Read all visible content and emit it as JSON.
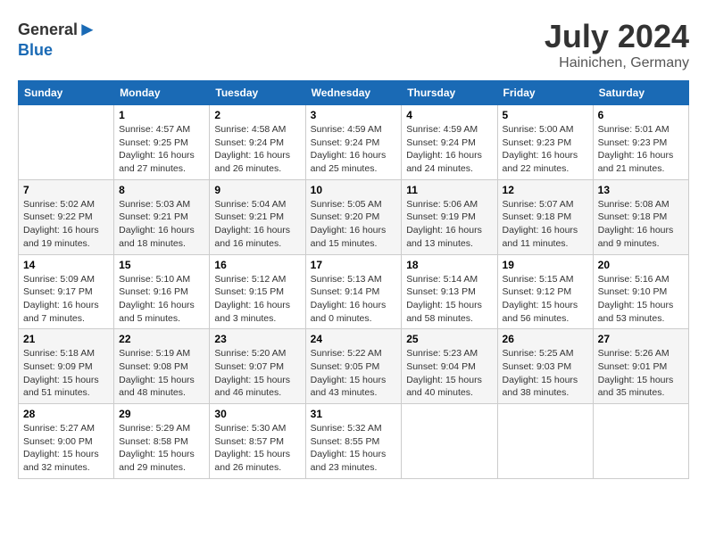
{
  "header": {
    "logo_general": "General",
    "logo_blue": "Blue",
    "month": "July 2024",
    "location": "Hainichen, Germany"
  },
  "weekdays": [
    "Sunday",
    "Monday",
    "Tuesday",
    "Wednesday",
    "Thursday",
    "Friday",
    "Saturday"
  ],
  "weeks": [
    [
      {
        "day": "",
        "info": ""
      },
      {
        "day": "1",
        "info": "Sunrise: 4:57 AM\nSunset: 9:25 PM\nDaylight: 16 hours\nand 27 minutes."
      },
      {
        "day": "2",
        "info": "Sunrise: 4:58 AM\nSunset: 9:24 PM\nDaylight: 16 hours\nand 26 minutes."
      },
      {
        "day": "3",
        "info": "Sunrise: 4:59 AM\nSunset: 9:24 PM\nDaylight: 16 hours\nand 25 minutes."
      },
      {
        "day": "4",
        "info": "Sunrise: 4:59 AM\nSunset: 9:24 PM\nDaylight: 16 hours\nand 24 minutes."
      },
      {
        "day": "5",
        "info": "Sunrise: 5:00 AM\nSunset: 9:23 PM\nDaylight: 16 hours\nand 22 minutes."
      },
      {
        "day": "6",
        "info": "Sunrise: 5:01 AM\nSunset: 9:23 PM\nDaylight: 16 hours\nand 21 minutes."
      }
    ],
    [
      {
        "day": "7",
        "info": "Sunrise: 5:02 AM\nSunset: 9:22 PM\nDaylight: 16 hours\nand 19 minutes."
      },
      {
        "day": "8",
        "info": "Sunrise: 5:03 AM\nSunset: 9:21 PM\nDaylight: 16 hours\nand 18 minutes."
      },
      {
        "day": "9",
        "info": "Sunrise: 5:04 AM\nSunset: 9:21 PM\nDaylight: 16 hours\nand 16 minutes."
      },
      {
        "day": "10",
        "info": "Sunrise: 5:05 AM\nSunset: 9:20 PM\nDaylight: 16 hours\nand 15 minutes."
      },
      {
        "day": "11",
        "info": "Sunrise: 5:06 AM\nSunset: 9:19 PM\nDaylight: 16 hours\nand 13 minutes."
      },
      {
        "day": "12",
        "info": "Sunrise: 5:07 AM\nSunset: 9:18 PM\nDaylight: 16 hours\nand 11 minutes."
      },
      {
        "day": "13",
        "info": "Sunrise: 5:08 AM\nSunset: 9:18 PM\nDaylight: 16 hours\nand 9 minutes."
      }
    ],
    [
      {
        "day": "14",
        "info": "Sunrise: 5:09 AM\nSunset: 9:17 PM\nDaylight: 16 hours\nand 7 minutes."
      },
      {
        "day": "15",
        "info": "Sunrise: 5:10 AM\nSunset: 9:16 PM\nDaylight: 16 hours\nand 5 minutes."
      },
      {
        "day": "16",
        "info": "Sunrise: 5:12 AM\nSunset: 9:15 PM\nDaylight: 16 hours\nand 3 minutes."
      },
      {
        "day": "17",
        "info": "Sunrise: 5:13 AM\nSunset: 9:14 PM\nDaylight: 16 hours\nand 0 minutes."
      },
      {
        "day": "18",
        "info": "Sunrise: 5:14 AM\nSunset: 9:13 PM\nDaylight: 15 hours\nand 58 minutes."
      },
      {
        "day": "19",
        "info": "Sunrise: 5:15 AM\nSunset: 9:12 PM\nDaylight: 15 hours\nand 56 minutes."
      },
      {
        "day": "20",
        "info": "Sunrise: 5:16 AM\nSunset: 9:10 PM\nDaylight: 15 hours\nand 53 minutes."
      }
    ],
    [
      {
        "day": "21",
        "info": "Sunrise: 5:18 AM\nSunset: 9:09 PM\nDaylight: 15 hours\nand 51 minutes."
      },
      {
        "day": "22",
        "info": "Sunrise: 5:19 AM\nSunset: 9:08 PM\nDaylight: 15 hours\nand 48 minutes."
      },
      {
        "day": "23",
        "info": "Sunrise: 5:20 AM\nSunset: 9:07 PM\nDaylight: 15 hours\nand 46 minutes."
      },
      {
        "day": "24",
        "info": "Sunrise: 5:22 AM\nSunset: 9:05 PM\nDaylight: 15 hours\nand 43 minutes."
      },
      {
        "day": "25",
        "info": "Sunrise: 5:23 AM\nSunset: 9:04 PM\nDaylight: 15 hours\nand 40 minutes."
      },
      {
        "day": "26",
        "info": "Sunrise: 5:25 AM\nSunset: 9:03 PM\nDaylight: 15 hours\nand 38 minutes."
      },
      {
        "day": "27",
        "info": "Sunrise: 5:26 AM\nSunset: 9:01 PM\nDaylight: 15 hours\nand 35 minutes."
      }
    ],
    [
      {
        "day": "28",
        "info": "Sunrise: 5:27 AM\nSunset: 9:00 PM\nDaylight: 15 hours\nand 32 minutes."
      },
      {
        "day": "29",
        "info": "Sunrise: 5:29 AM\nSunset: 8:58 PM\nDaylight: 15 hours\nand 29 minutes."
      },
      {
        "day": "30",
        "info": "Sunrise: 5:30 AM\nSunset: 8:57 PM\nDaylight: 15 hours\nand 26 minutes."
      },
      {
        "day": "31",
        "info": "Sunrise: 5:32 AM\nSunset: 8:55 PM\nDaylight: 15 hours\nand 23 minutes."
      },
      {
        "day": "",
        "info": ""
      },
      {
        "day": "",
        "info": ""
      },
      {
        "day": "",
        "info": ""
      }
    ]
  ]
}
